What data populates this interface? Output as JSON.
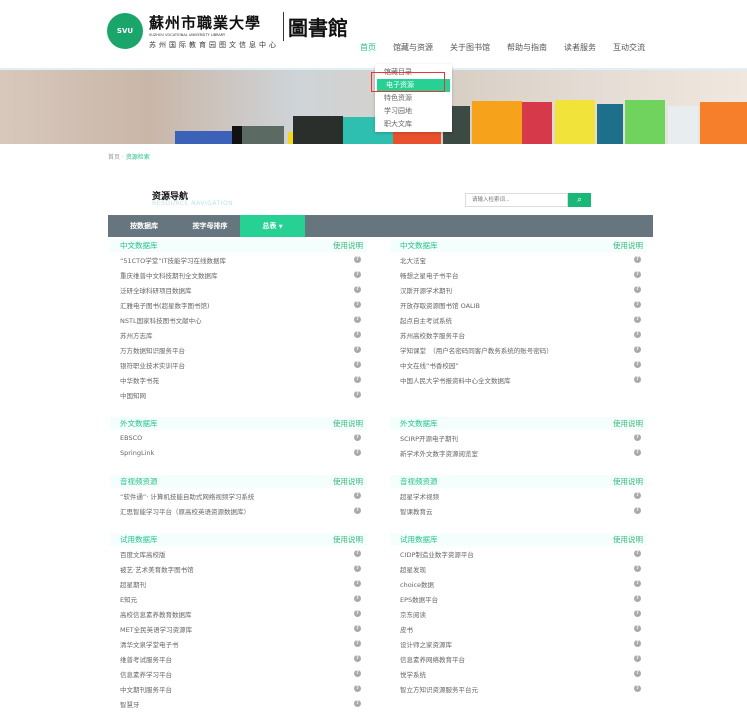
{
  "header": {
    "logo_badge": "SVU",
    "logo_cn": "蘇州市職業大學",
    "logo_en": "SUZHOU VOCATIONAL UNIVERSITY LIBRARY",
    "logo_sub": "苏州国际教育园图文信息中心",
    "logo_lib": "圖書館"
  },
  "nav": [
    "首页",
    "馆藏与资源",
    "关于图书馆",
    "帮助与指南",
    "读者服务",
    "互动交流"
  ],
  "dropdown": [
    "馆藏目录",
    "电子资源",
    "特色资源",
    "学习园地",
    "职大文库"
  ],
  "breadcrumb": {
    "home": "首页",
    "sep": " · ",
    "current": "资源检索"
  },
  "section_title": "资源导航",
  "section_title_en": "RESOURCE NAVIGATION",
  "search": {
    "placeholder": "请输入检索词...",
    "icon": "search-icon"
  },
  "tabs": [
    "按数据库",
    "按字母排序",
    "总表"
  ],
  "accent": "#26d193",
  "help_label": "使用说明",
  "sections": [
    {
      "name": "中文数据库",
      "left": [
        "“51CTO学堂”IT技能学习在线数据库",
        "重庆维普中文科技期刊全文数据库",
        "泛研全球科研项目数据库",
        "汇雅电子图书(超星数字图书馆)",
        "NSTL国家科技图书文献中心",
        "苏州方志库",
        "万方数据知识服务平台",
        "银符职业技术实训平台",
        "中华数字书苑",
        "中国知网"
      ],
      "right": [
        "北大法宝",
        "畅想之星电子书平台",
        "汉斯开源学术期刊",
        "开放存取资源图书馆 OALIB",
        "起点自主考试系统",
        "苏州高校数字服务平台",
        "学知课堂　（用户名密码同客户教务系统的账号密码）",
        "中文在线“书香校园”",
        "中国人民大学书报资料中心全文数据库"
      ]
    },
    {
      "name": "外文数据库",
      "left": [
        "EBSCO",
        "SpringLink"
      ],
      "right": [
        "SCIRP开源电子期刊",
        "新学术外文数字资源阅览室"
      ]
    },
    {
      "name": "音视频资源",
      "left": [
        "“软件通”· 计算机技能自助式网络视频学习系统",
        "汇思智能学习平台（原高校英语资源数据库）"
      ],
      "right": [
        "超星学术视频",
        "智课教育云"
      ]
    },
    {
      "name": "试用数据库",
      "left": [
        "百度文库高校版",
        "被艺·艺术美育数字图书馆",
        "超星期刊",
        "E知元",
        "高校信息素养教育数据库",
        "MET全民英语学习资源库",
        "清华文泉学堂电子书",
        "维普考试服务平台",
        "信息素养学习平台",
        "中文期刊服务平台",
        "智慧牙"
      ],
      "right": [
        "CIDP制造业数字资源平台",
        "超星发现",
        "choice数据",
        "EPS数据平台",
        "京东阅读",
        "皮书",
        "设计师之家资源库",
        "信息素养网络教育平台",
        "悦学系统",
        "智立方知识资源服务平台元"
      ]
    }
  ]
}
